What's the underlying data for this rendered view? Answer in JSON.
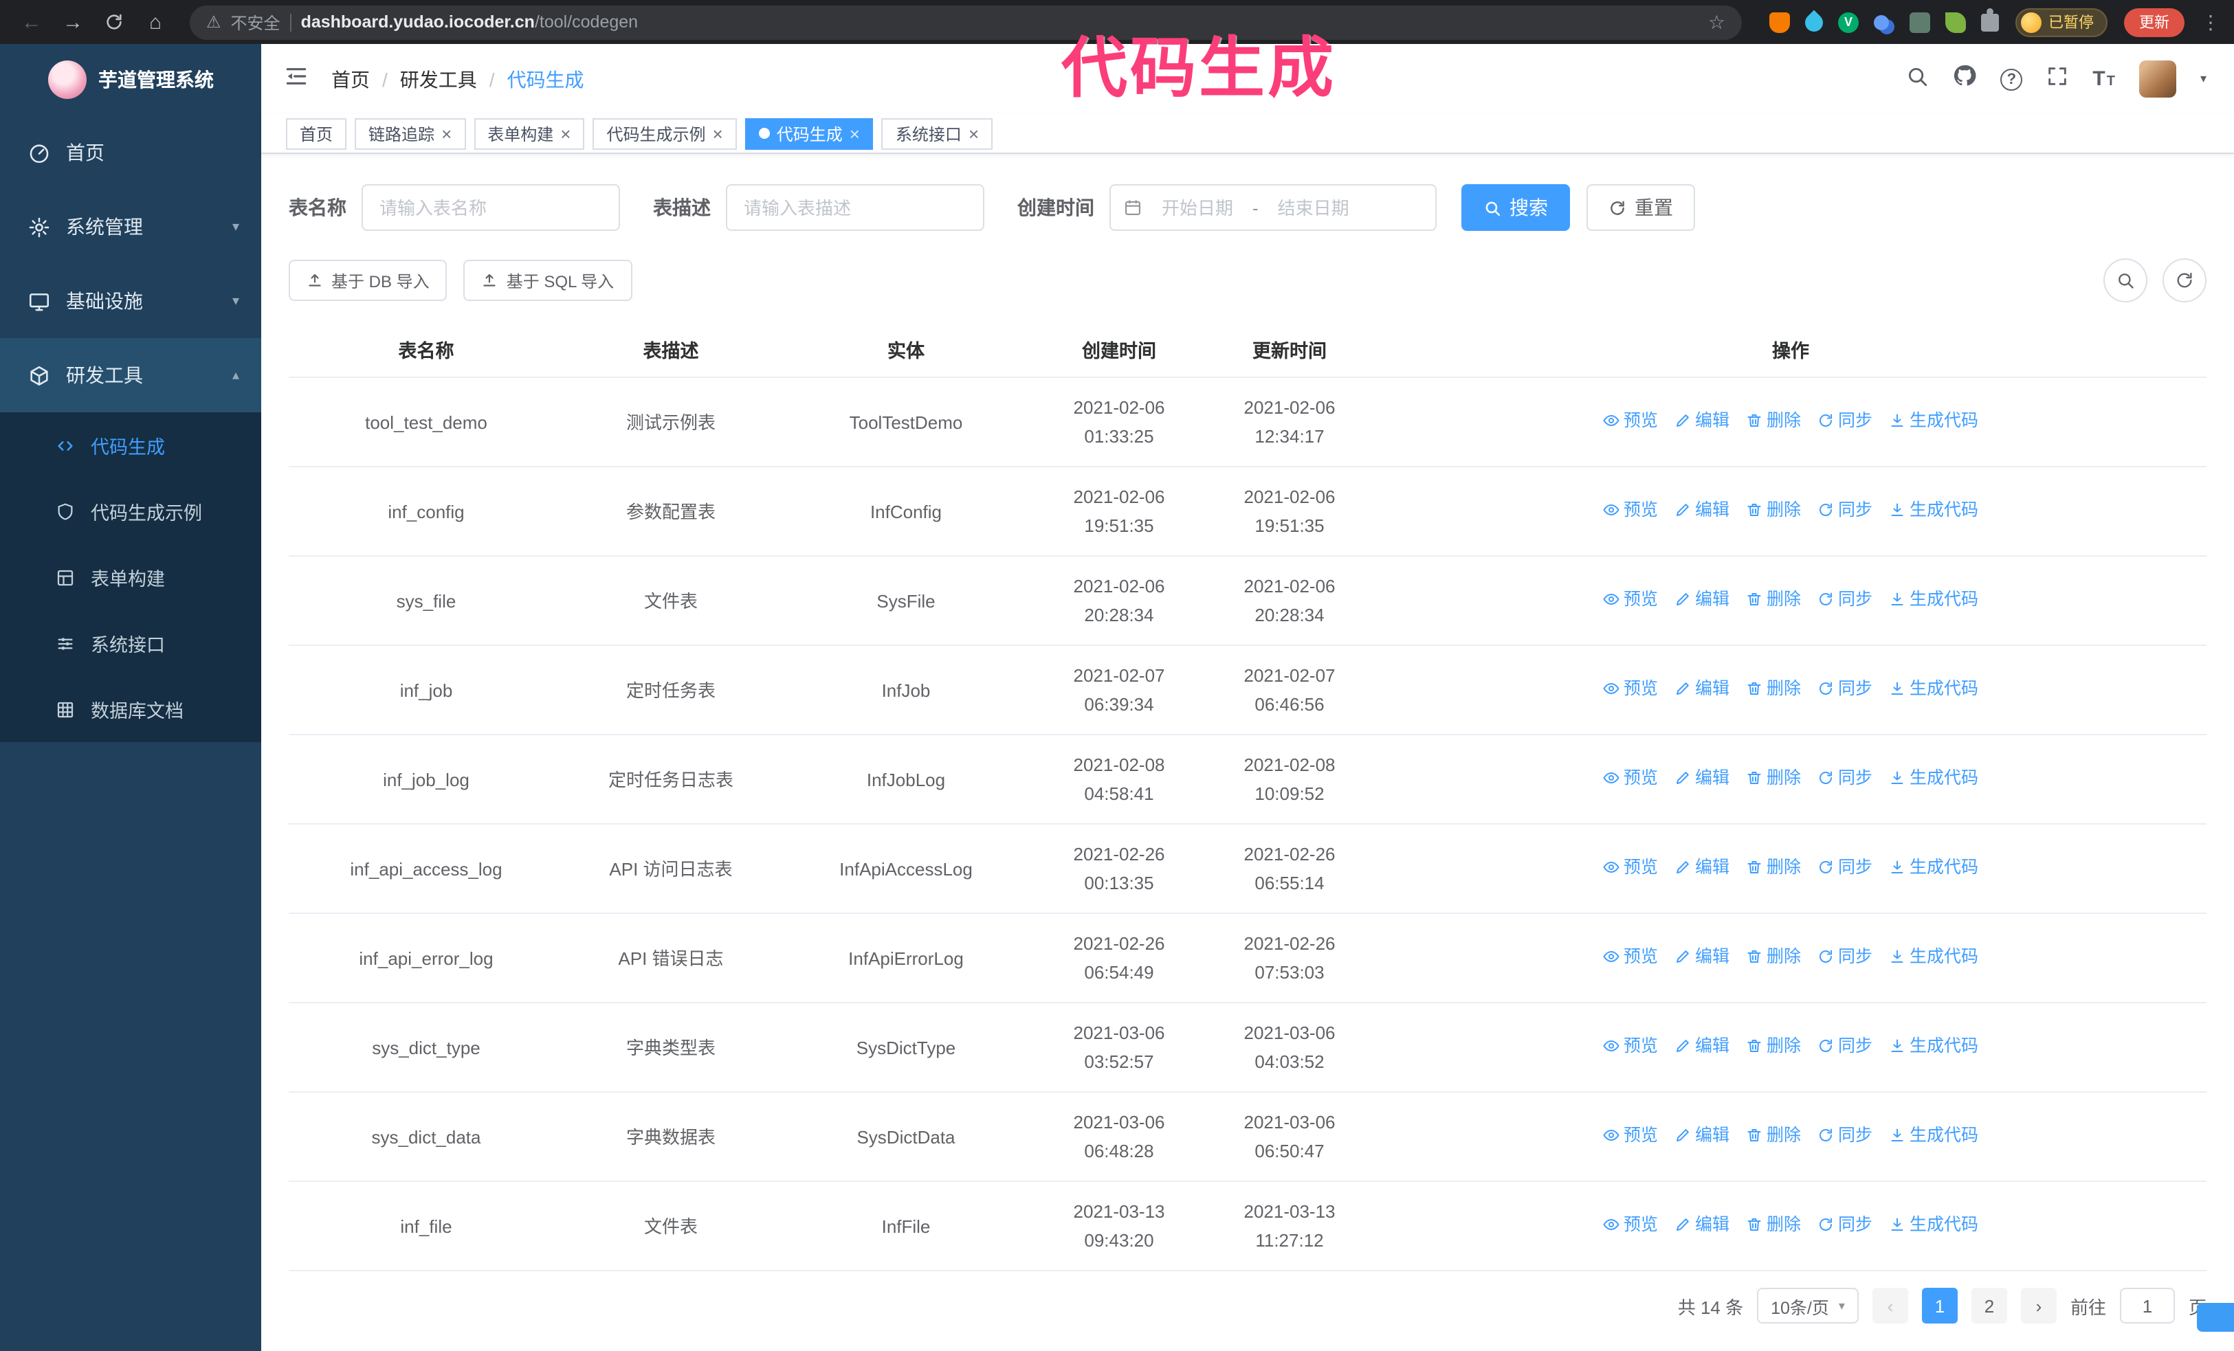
{
  "colors": {
    "accent": "#409eff",
    "sidebar_bg": "#20405c",
    "submenu_bg": "#152e43",
    "annotation": "#fb3e7a"
  },
  "browser": {
    "security_label": "不安全",
    "url_host": "dashboard.yudao.iocoder.cn",
    "url_path": "/tool/codegen",
    "paused_label": "已暂停",
    "update_label": "更新"
  },
  "annotation_text": "代码生成",
  "sidebar": {
    "title": "芋道管理系统",
    "items": [
      {
        "label": "首页"
      },
      {
        "label": "系统管理"
      },
      {
        "label": "基础设施"
      },
      {
        "label": "研发工具"
      }
    ],
    "subitems": [
      {
        "label": "代码生成"
      },
      {
        "label": "代码生成示例"
      },
      {
        "label": "表单构建"
      },
      {
        "label": "系统接口"
      },
      {
        "label": "数据库文档"
      }
    ]
  },
  "breadcrumb": [
    "首页",
    "研发工具",
    "代码生成"
  ],
  "tabs": [
    {
      "label": "首页",
      "closable": false,
      "active": false
    },
    {
      "label": "链路追踪",
      "closable": true,
      "active": false
    },
    {
      "label": "表单构建",
      "closable": true,
      "active": false
    },
    {
      "label": "代码生成示例",
      "closable": true,
      "active": false
    },
    {
      "label": "代码生成",
      "closable": true,
      "active": true
    },
    {
      "label": "系统接口",
      "closable": true,
      "active": false
    }
  ],
  "filters": {
    "table_name_label": "表名称",
    "table_name_placeholder": "请输入表名称",
    "table_desc_label": "表描述",
    "table_desc_placeholder": "请输入表描述",
    "create_time_label": "创建时间",
    "date_start_placeholder": "开始日期",
    "date_separator": "-",
    "date_end_placeholder": "结束日期",
    "search_button": "搜索",
    "reset_button": "重置"
  },
  "toolbar": {
    "import_db_button": "基于 DB 导入",
    "import_sql_button": "基于 SQL 导入"
  },
  "table": {
    "columns": [
      "表名称",
      "表描述",
      "实体",
      "创建时间",
      "更新时间",
      "操作"
    ],
    "action_labels": [
      "预览",
      "编辑",
      "删除",
      "同步",
      "生成代码"
    ],
    "rows": [
      {
        "name": "tool_test_demo",
        "desc": "测试示例表",
        "entity": "ToolTestDemo",
        "created": "2021-02-06 01:33:25",
        "updated": "2021-02-06 12:34:17"
      },
      {
        "name": "inf_config",
        "desc": "参数配置表",
        "entity": "InfConfig",
        "created": "2021-02-06 19:51:35",
        "updated": "2021-02-06 19:51:35"
      },
      {
        "name": "sys_file",
        "desc": "文件表",
        "entity": "SysFile",
        "created": "2021-02-06 20:28:34",
        "updated": "2021-02-06 20:28:34"
      },
      {
        "name": "inf_job",
        "desc": "定时任务表",
        "entity": "InfJob",
        "created": "2021-02-07 06:39:34",
        "updated": "2021-02-07 06:46:56"
      },
      {
        "name": "inf_job_log",
        "desc": "定时任务日志表",
        "entity": "InfJobLog",
        "created": "2021-02-08 04:58:41",
        "updated": "2021-02-08 10:09:52"
      },
      {
        "name": "inf_api_access_log",
        "desc": "API 访问日志表",
        "entity": "InfApiAccessLog",
        "created": "2021-02-26 00:13:35",
        "updated": "2021-02-26 06:55:14"
      },
      {
        "name": "inf_api_error_log",
        "desc": "API 错误日志",
        "entity": "InfApiErrorLog",
        "created": "2021-02-26 06:54:49",
        "updated": "2021-02-26 07:53:03"
      },
      {
        "name": "sys_dict_type",
        "desc": "字典类型表",
        "entity": "SysDictType",
        "created": "2021-03-06 03:52:57",
        "updated": "2021-03-06 04:03:52"
      },
      {
        "name": "sys_dict_data",
        "desc": "字典数据表",
        "entity": "SysDictData",
        "created": "2021-03-06 06:48:28",
        "updated": "2021-03-06 06:50:47"
      },
      {
        "name": "inf_file",
        "desc": "文件表",
        "entity": "InfFile",
        "created": "2021-03-13 09:43:20",
        "updated": "2021-03-13 11:27:12"
      }
    ]
  },
  "pagination": {
    "total": "共 14 条",
    "page_size": "10条/页",
    "pages": [
      "1",
      "2"
    ],
    "goto_label": "前往",
    "goto_value": "1",
    "page_unit": "页"
  }
}
